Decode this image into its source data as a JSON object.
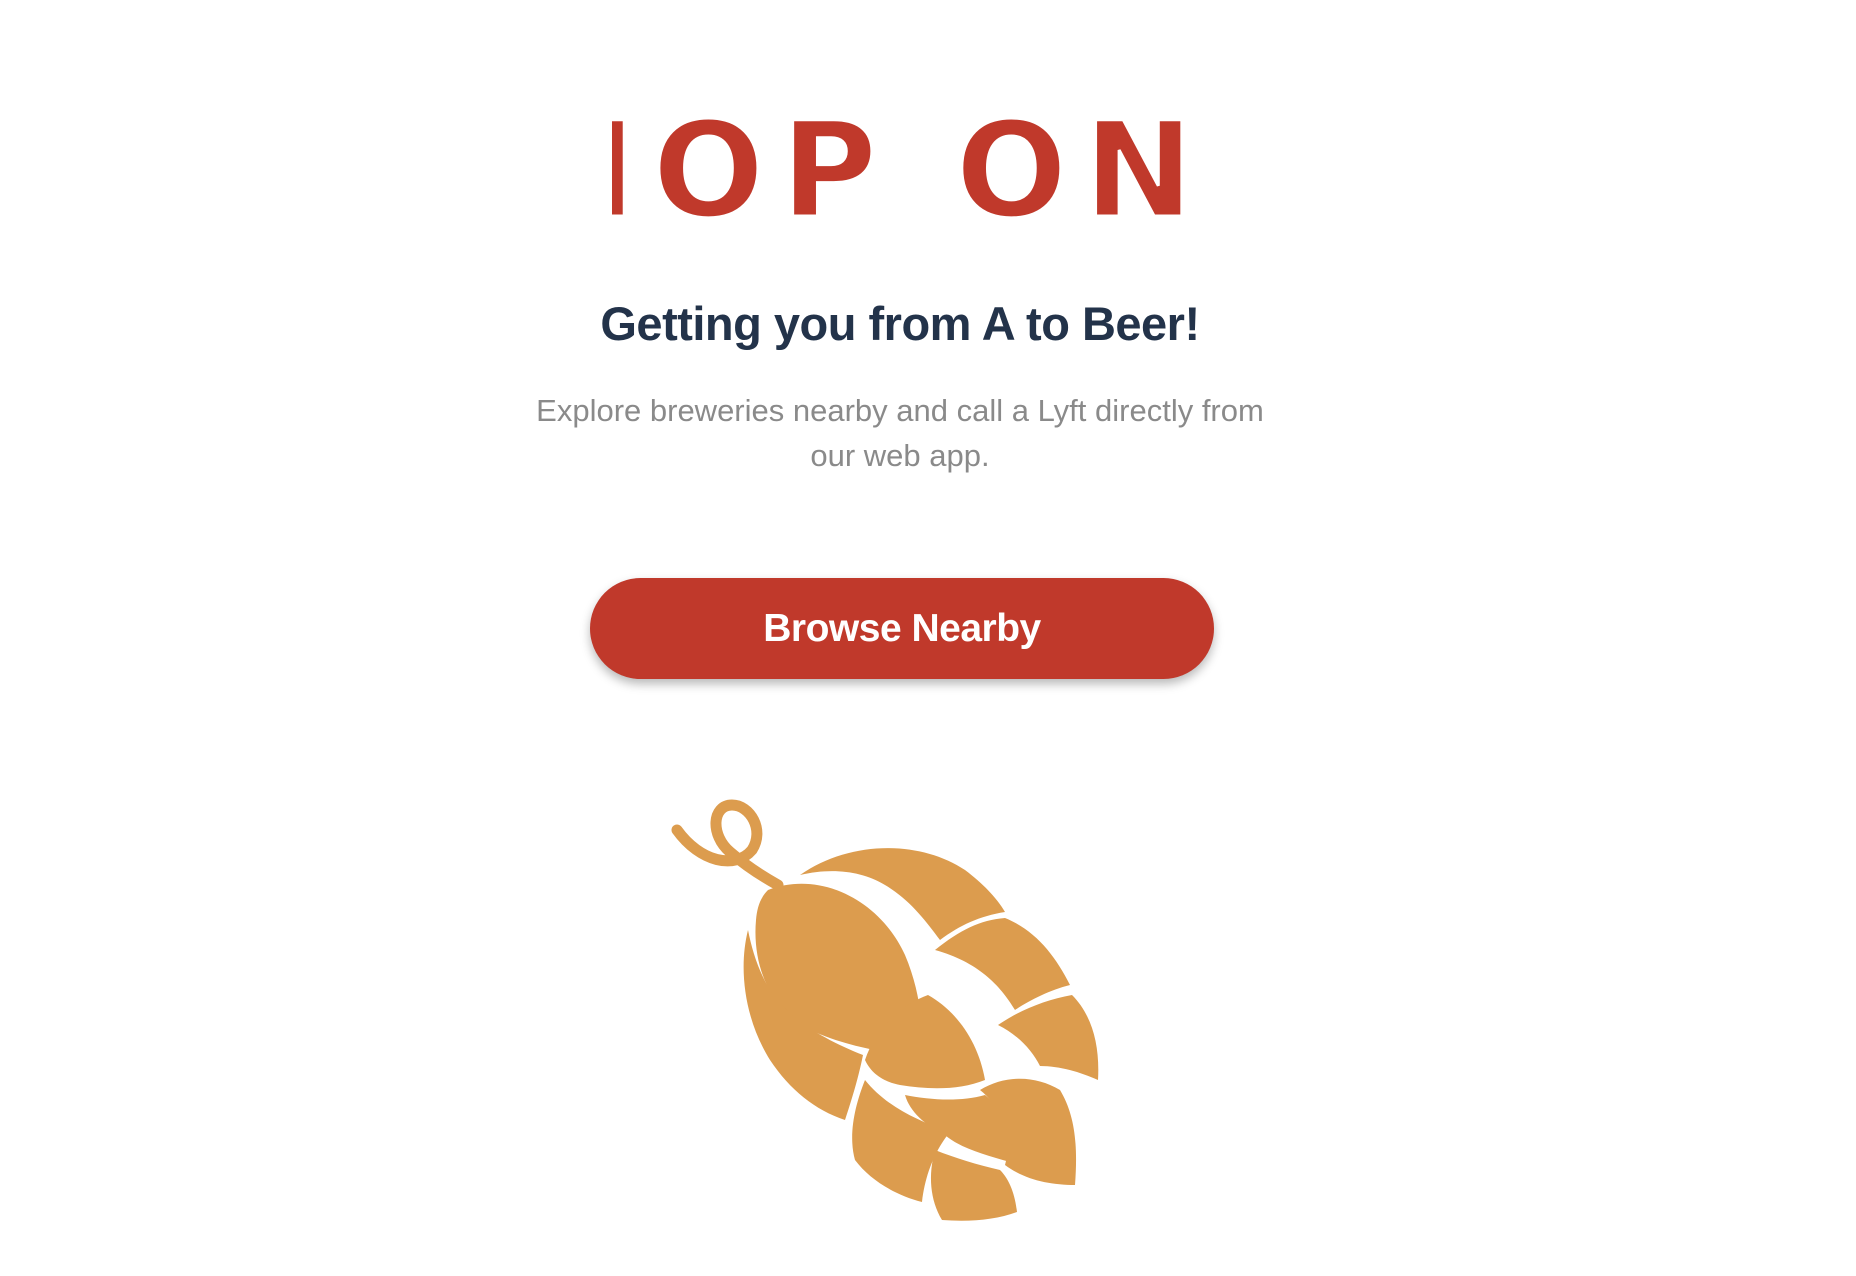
{
  "logo": {
    "text": "HOP ON!",
    "color": "#c0392b"
  },
  "hero": {
    "tagline": "Getting you from A to Beer!",
    "description": "Explore breweries nearby and call a Lyft directly from our web app."
  },
  "actions": {
    "browse_label": "Browse Nearby"
  },
  "colors": {
    "brand_red": "#c0392b",
    "heading_navy": "#23334a",
    "body_gray": "#8a8a8a",
    "hop_orange": "#dc9c4e"
  },
  "illustration": {
    "icon": "hop-cone-icon"
  }
}
